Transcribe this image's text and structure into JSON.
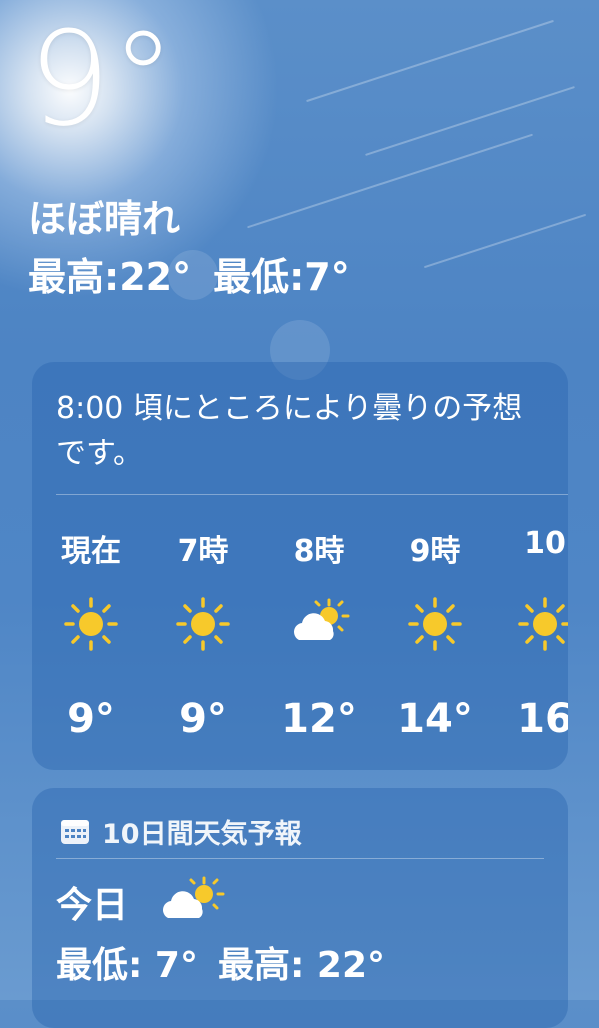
{
  "current": {
    "temperature": "9°",
    "condition": "ほぼ晴れ",
    "high": "最高:22°",
    "low": "最低:7°"
  },
  "hourly": {
    "summary": "8:00 頃にところにより曇りの予想です。",
    "hours": [
      {
        "time": "現在",
        "icon": "sun-icon",
        "temp": "9°"
      },
      {
        "time": "7時",
        "icon": "sun-icon",
        "temp": "9°"
      },
      {
        "time": "8時",
        "icon": "partly-cloudy-icon",
        "temp": "12°"
      },
      {
        "time": "9時",
        "icon": "sun-icon",
        "temp": "14°"
      },
      {
        "time": "10",
        "icon": "sun-icon",
        "temp": "16"
      }
    ]
  },
  "daily": {
    "header": "10日間天気予報",
    "today_label": "今日",
    "today_icon": "partly-cloudy-icon",
    "today_low": "最低: 7°",
    "today_high": "最高: 22°"
  },
  "colors": {
    "sun": "#f7c92b",
    "cloud": "#ffffff",
    "sky": "#4d84c4"
  }
}
